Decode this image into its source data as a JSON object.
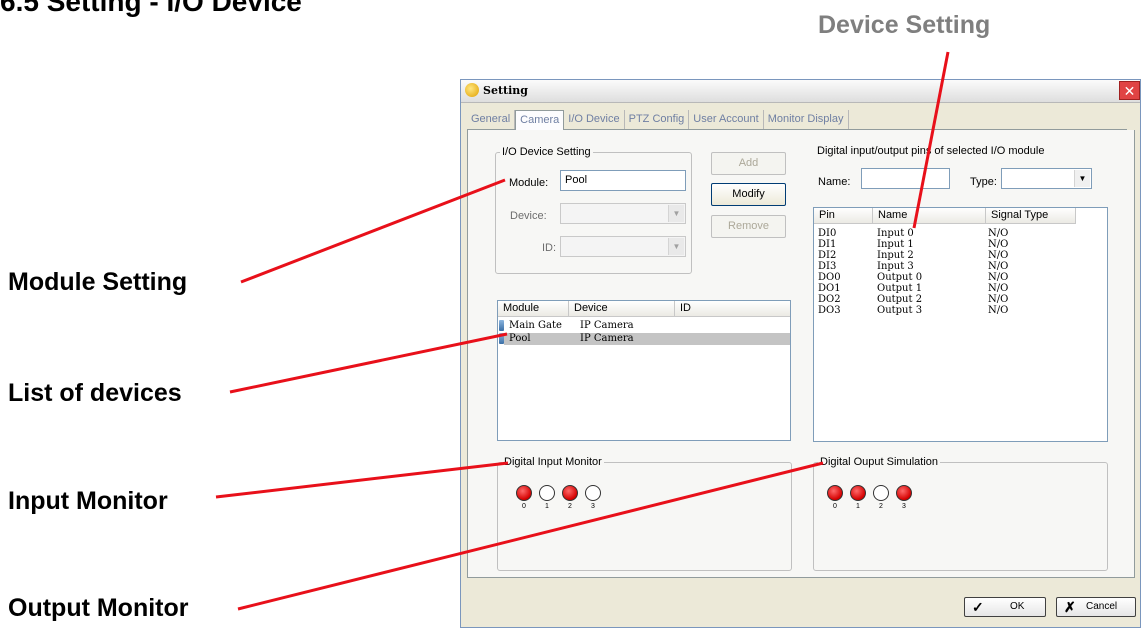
{
  "heading": "6.5 Setting - I/O Device",
  "annotations": {
    "device_setting": "Device Setting",
    "module_setting": "Module Setting",
    "list_of_devices": "List of devices",
    "input_monitor": "Input Monitor",
    "output_monitor": "Output Monitor"
  },
  "colors": {
    "annotation_line": "#e8101a",
    "led_on": "#d40000",
    "accent_grey": "#7f7f7f"
  },
  "window": {
    "title": "Setting",
    "icon": "setting-icon",
    "close_label": "✕"
  },
  "tabs": [
    "General",
    "Camera",
    "I/O Device",
    "PTZ Config",
    "User Account",
    "Monitor Display"
  ],
  "active_tab": "Camera",
  "io_device_setting": {
    "legend": "I/O Device Setting",
    "module_label": "Module:",
    "module_value": "Pool",
    "device_label": "Device:",
    "device_value": "",
    "id_label": "ID:",
    "id_value": ""
  },
  "buttons": {
    "add": "Add",
    "modify": "Modify",
    "remove": "Remove",
    "ok": "OK",
    "cancel": "Cancel"
  },
  "device_list": {
    "columns": [
      "Module",
      "Device",
      "ID"
    ],
    "rows": [
      {
        "module": "Main Gate",
        "device": "IP Camera",
        "id": "",
        "selected": false
      },
      {
        "module": "Pool",
        "device": "IP Camera",
        "id": "",
        "selected": true
      }
    ]
  },
  "pins": {
    "title": "Digital input/output pins of selected I/O module",
    "name_label": "Name:",
    "name_value": "",
    "type_label": "Type:",
    "type_value": "",
    "columns": [
      "Pin",
      "Name",
      "Signal Type"
    ],
    "rows": [
      {
        "pin": "DI0",
        "name": "Input 0",
        "signal": "N/O"
      },
      {
        "pin": "DI1",
        "name": "Input 1",
        "signal": "N/O"
      },
      {
        "pin": "DI2",
        "name": "Input 2",
        "signal": "N/O"
      },
      {
        "pin": "DI3",
        "name": "Input 3",
        "signal": "N/O"
      },
      {
        "pin": "DO0",
        "name": "Output 0",
        "signal": "N/O"
      },
      {
        "pin": "DO1",
        "name": "Output 1",
        "signal": "N/O"
      },
      {
        "pin": "DO2",
        "name": "Output 2",
        "signal": "N/O"
      },
      {
        "pin": "DO3",
        "name": "Output 3",
        "signal": "N/O"
      }
    ]
  },
  "input_monitor": {
    "legend": "Digital Input Monitor",
    "leds": [
      {
        "label": "0",
        "on": true
      },
      {
        "label": "1",
        "on": false
      },
      {
        "label": "2",
        "on": true
      },
      {
        "label": "3",
        "on": false
      }
    ]
  },
  "output_simulation": {
    "legend": "Digital Ouput Simulation",
    "leds": [
      {
        "label": "0",
        "on": true
      },
      {
        "label": "1",
        "on": true
      },
      {
        "label": "2",
        "on": false
      },
      {
        "label": "3",
        "on": true
      }
    ]
  }
}
